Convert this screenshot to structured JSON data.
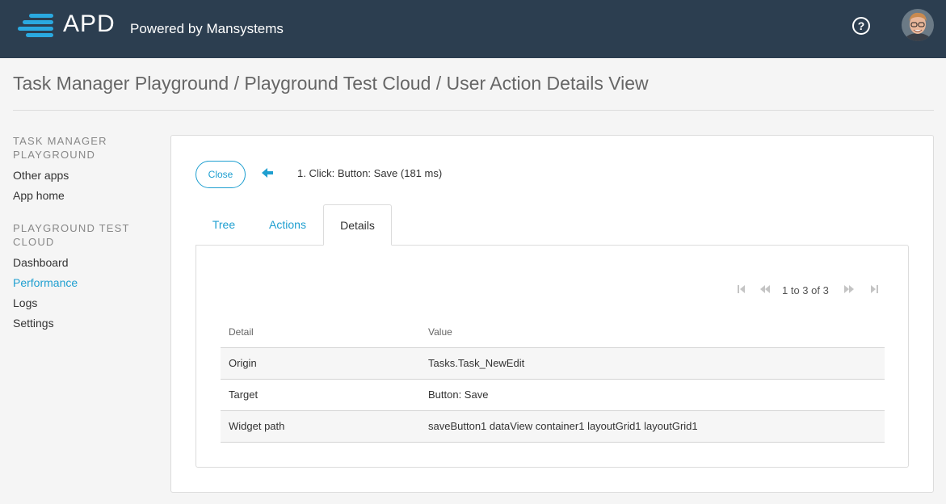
{
  "header": {
    "logo_text": "APD",
    "logo_subtitle": "Powered by Mansystems",
    "help_glyph": "?",
    "accent_color": "#2aa9e0",
    "background_color": "#2c3e50"
  },
  "page": {
    "title": "Task Manager Playground / Playground Test Cloud / User Action Details View"
  },
  "sidebar": {
    "groups": [
      {
        "heading": "TASK MANAGER PLAYGROUND",
        "items": [
          {
            "label": "Other apps"
          },
          {
            "label": "App home"
          }
        ]
      },
      {
        "heading": "PLAYGROUND TEST CLOUD",
        "items": [
          {
            "label": "Dashboard"
          },
          {
            "label": "Performance"
          },
          {
            "label": "Logs"
          },
          {
            "label": "Settings"
          }
        ]
      }
    ],
    "active_item": "Performance",
    "link_color": "#1f9fd0"
  },
  "detail": {
    "close_label": "Close",
    "action_title": "1. Click: Button: Save (181 ms)",
    "back_icon": "arrow-left-icon"
  },
  "tabs": [
    {
      "label": "Tree"
    },
    {
      "label": "Actions"
    },
    {
      "label": "Details"
    }
  ],
  "active_tab": "Details",
  "pager": {
    "text": "1 to 3 of 3",
    "icons": [
      "first-page-icon",
      "previous-page-icon",
      "next-page-icon",
      "last-page-icon"
    ]
  },
  "table": {
    "columns": [
      "Detail",
      "Value"
    ],
    "rows": [
      {
        "detail": "Origin",
        "value": "Tasks.Task_NewEdit"
      },
      {
        "detail": "Target",
        "value": "Button: Save"
      },
      {
        "detail": "Widget path",
        "value": "saveButton1 dataView container1 layoutGrid1 layoutGrid1"
      }
    ]
  }
}
